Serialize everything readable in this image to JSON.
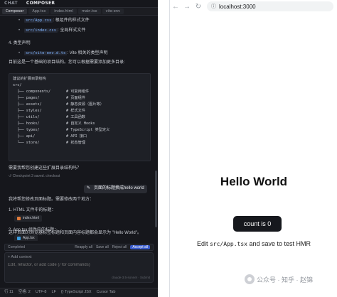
{
  "editor": {
    "top_tabs": [
      "CHAT",
      "COMPOSER"
    ],
    "file_tabs": [
      "Composer",
      "App.tsx",
      "index.html",
      "main.tsx",
      "vite-env"
    ],
    "lines": [
      {
        "kind": "bullet",
        "code": "src/App.css",
        "text": ": 根组件的样式文件"
      },
      {
        "kind": "bullet",
        "code": "src/index.css",
        "text": ": 全局样式文件"
      },
      {
        "kind": "heading",
        "text": "4. 类型声明"
      },
      {
        "kind": "bullet",
        "code": "src/vite-env.d.ts",
        "text": ": Vite 相关的类型声明"
      },
      {
        "kind": "plain",
        "text": "目前这是一个基础的项目结构。您可以根据需要添加更多目录:"
      }
    ],
    "codeblock": [
      "建议的扩展目录结构",
      "src/",
      "  ├── components/       # 可复用组件",
      "  ├── pages/            # 页面组件",
      "  ├── assets/           # 静态资源（图片等）",
      "  ├── styles/           # 样式文件",
      "  ├── utils/            # 工具函数",
      "  ├── hooks/            # 自定义 Hooks",
      "  ├── types/            # TypeScript 类型定义",
      "  ├── api/              # API 接口",
      "  └── store/            # 状态管理"
    ],
    "question": "需要我帮您创建这些扩展目录结构吗？",
    "checkpoint": "Checkpoint 3 saved. checkout",
    "user_message": "页面的标题换成hello world",
    "answer_intro": "我将帮您修改页面标题。需要修改两个地方：",
    "step1": "1. HTML 文件中的标题：",
    "step1_file": "index.html",
    "step2": "2. App.tsx 组件中的标题：",
    "step2_file": "App.tsx",
    "summary": "这样页面的浏览器标签标题和页面内容标题都会显示为 \"Hello World\"。",
    "changes": {
      "label": "Completed",
      "buttons": [
        "Reapply all",
        "Save all",
        "Reject all",
        "Accept all"
      ]
    },
    "composer": {
      "add_context": "+ Add context",
      "placeholder": "Edit, refactor, or add code (/ for commands)",
      "model": "claude-3.5-sonnet · Submit"
    },
    "status": [
      "行 11",
      "空格: 2",
      "UTF-8",
      "LF",
      "{} TypeScript JSX",
      "Cursor Tab"
    ]
  },
  "browser": {
    "url": "localhost:3000",
    "heading": "Hello World",
    "count_button": "count is 0",
    "hmr_prefix": "Edit ",
    "hmr_code": "src/App.tsx",
    "hmr_suffix": " and save to test HMR"
  },
  "watermark": {
    "text": "公众号 · 知乎 · 赵锦"
  }
}
